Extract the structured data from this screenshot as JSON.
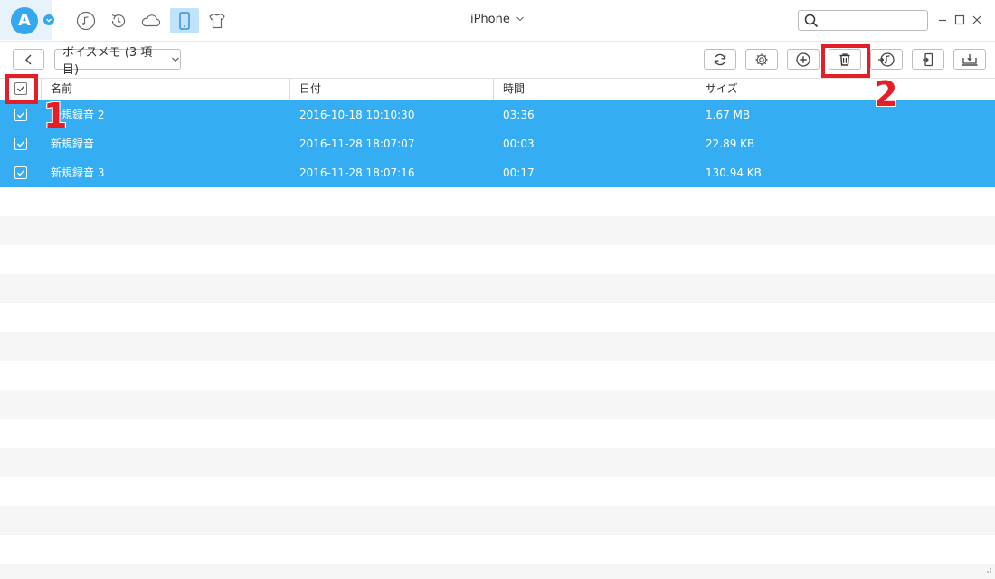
{
  "app": {
    "device_title": "iPhone",
    "logo_letter": "A"
  },
  "nav": [
    {
      "icon": "music-note-icon"
    },
    {
      "icon": "history-icon"
    },
    {
      "icon": "cloud-icon"
    },
    {
      "icon": "phone-icon",
      "active": true
    },
    {
      "icon": "tshirt-icon"
    }
  ],
  "search": {
    "placeholder": ""
  },
  "toolbar": {
    "category_label": "ボイスメモ (3 項目)",
    "buttons": [
      "refresh-icon",
      "settings-icon",
      "add-icon",
      "delete-icon",
      "to-itunes-icon",
      "to-pc-icon",
      "to-device-icon"
    ]
  },
  "table": {
    "columns": [
      "名前",
      "日付",
      "時間",
      "サイズ"
    ],
    "rows": [
      {
        "name": "新規録音 2",
        "date": "2016-10-18 10:10:30",
        "duration": "03:36",
        "size": "1.67 MB"
      },
      {
        "name": "新規録音",
        "date": "2016-11-28 18:07:07",
        "duration": "00:03",
        "size": "22.89 KB"
      },
      {
        "name": "新規録音 3",
        "date": "2016-11-28 18:07:16",
        "duration": "00:17",
        "size": "130.94 KB"
      }
    ]
  },
  "annotations": {
    "step1": "1",
    "step2": "2"
  },
  "colors": {
    "accent": "#35adf3",
    "highlight": "#e41e26",
    "stripe": "#f6f6f6"
  }
}
